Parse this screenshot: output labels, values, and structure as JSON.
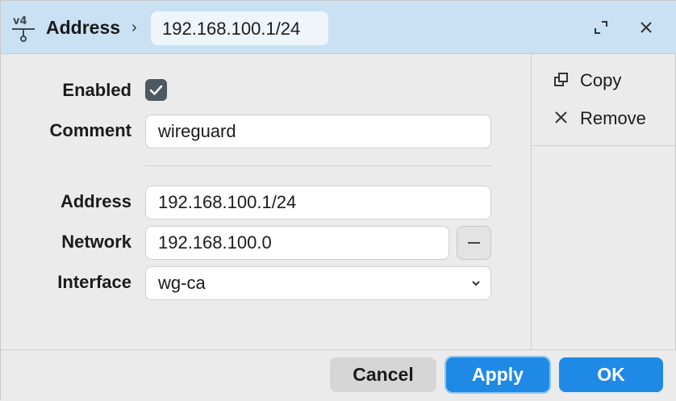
{
  "titlebar": {
    "icon_label": "v4",
    "title": "Address",
    "current": "192.168.100.1/24"
  },
  "form": {
    "enabled_label": "Enabled",
    "enabled_checked": true,
    "comment_label": "Comment",
    "comment_value": "wireguard",
    "address_label": "Address",
    "address_value": "192.168.100.1/24",
    "network_label": "Network",
    "network_value": "192.168.100.0",
    "interface_label": "Interface",
    "interface_value": "wg-ca"
  },
  "sidebar": {
    "copy_label": "Copy",
    "remove_label": "Remove"
  },
  "footer": {
    "cancel_label": "Cancel",
    "apply_label": "Apply",
    "ok_label": "OK"
  },
  "colors": {
    "titlebar": "#c9e1f3",
    "primary": "#1f8ae6",
    "checkbox": "#4e5861"
  },
  "icons": [
    "ipv4-address-icon",
    "chevron-right-icon",
    "expand-icon",
    "close-icon",
    "checkmark-icon",
    "minus-icon",
    "chevron-down-icon",
    "copy-icon",
    "remove-icon"
  ]
}
